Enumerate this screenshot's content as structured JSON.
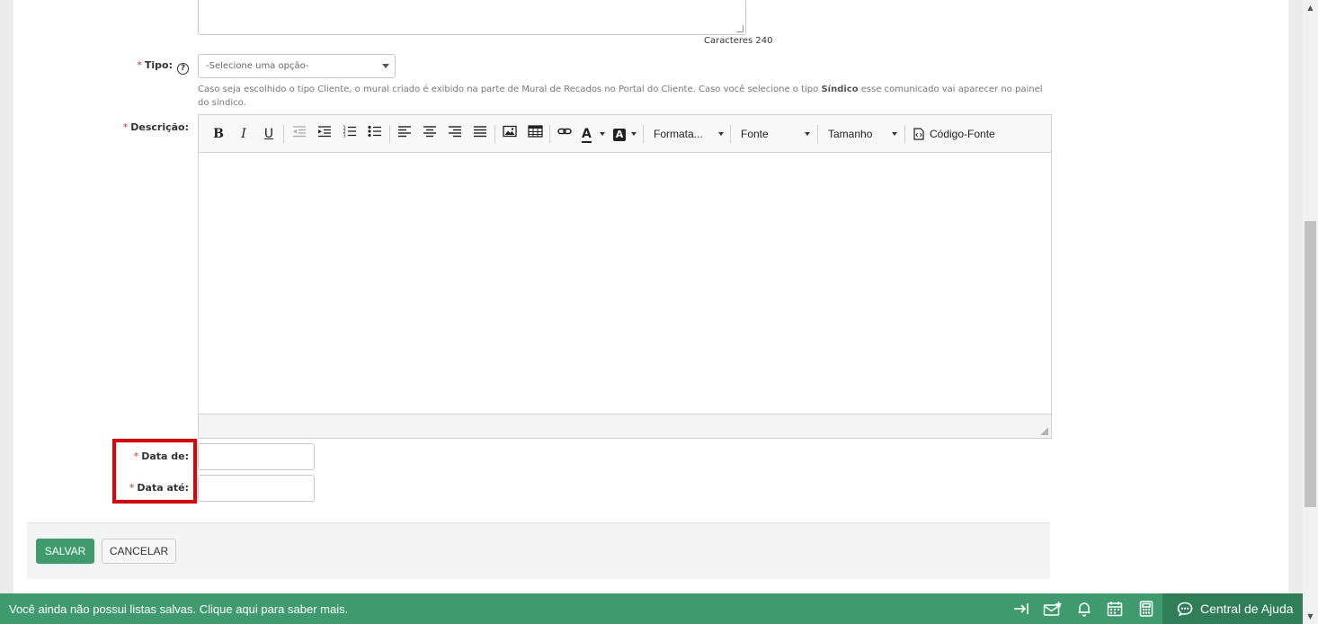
{
  "form": {
    "char_count": "Caracteres 240",
    "tipo_label": "Tipo:",
    "required_mark": "*",
    "tipo_help_icon": "?",
    "tipo_placeholder": "-Selecione uma opção-",
    "hint_part1": "Caso seja escolhido o tipo Cliente, o mural criado é exibido na parte de Mural de Recados no Portal do Cliente. Caso você selecione o tipo ",
    "hint_bold": "Síndico",
    "hint_part2": " esse comunicado vai aparecer no painel do síndico.",
    "descricao_label": "Descrição:",
    "data_de_label": "Data de:",
    "data_ate_label": "Data até:"
  },
  "editor": {
    "toolbar": {
      "bold": "B",
      "italic": "I",
      "underline": "U",
      "format_label": "Formata...",
      "font_label": "Fonte",
      "size_label": "Tamanho",
      "source_label": "Código-Fonte",
      "text_color_glyph": "A",
      "bg_color_glyph": "A"
    }
  },
  "actions": {
    "save_label": "SALVAR",
    "cancel_label": "CANCELAR"
  },
  "bottom_bar": {
    "message": "Você ainda não possui listas salvas. Clique aqui para saber mais.",
    "help_center_label": "Central de Ajuda",
    "icons": [
      "collapse-arrow-icon",
      "mail-star-icon",
      "bell-icon",
      "calendar-icon",
      "calculator-icon",
      "chat-help-icon"
    ]
  },
  "colors": {
    "primary_green": "#3f9b6d",
    "help_center_bg": "#2f7e57",
    "highlight_red": "#e30000"
  }
}
